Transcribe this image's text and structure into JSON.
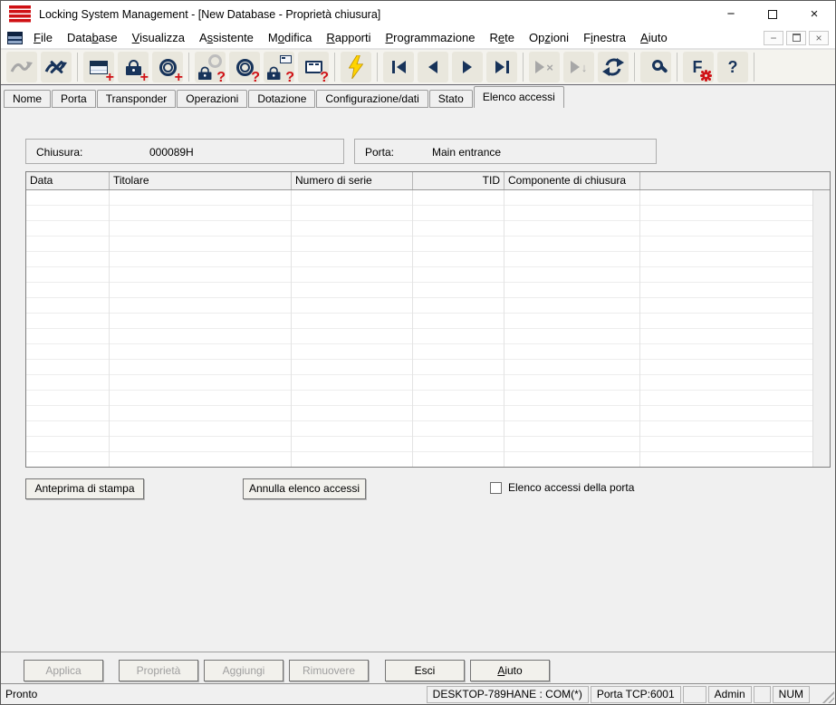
{
  "window": {
    "title": "Locking System Management - [New Database - Proprietà chiusura]",
    "controls": {
      "minimize": "−",
      "close": "×"
    }
  },
  "menubar": {
    "items": [
      {
        "pre": "",
        "key": "F",
        "post": "ile"
      },
      {
        "pre": "Data",
        "key": "b",
        "post": "ase"
      },
      {
        "pre": "",
        "key": "V",
        "post": "isualizza"
      },
      {
        "pre": "A",
        "key": "s",
        "post": "sistente"
      },
      {
        "pre": "M",
        "key": "o",
        "post": "difica"
      },
      {
        "pre": "",
        "key": "R",
        "post": "apporti"
      },
      {
        "pre": "",
        "key": "P",
        "post": "rogrammazione"
      },
      {
        "pre": "R",
        "key": "e",
        "post": "te"
      },
      {
        "pre": "Op",
        "key": "z",
        "post": "ioni"
      },
      {
        "pre": "F",
        "key": "i",
        "post": "nestra"
      },
      {
        "pre": "",
        "key": "A",
        "post": "iuto"
      }
    ]
  },
  "toolbar": {
    "icon_names": [
      "connect",
      "disconnect",
      "new-locking-plan",
      "new-lock",
      "new-transponder",
      "read-lock",
      "read-transponder",
      "read-network-lock",
      "read-settings",
      "program",
      "first-record",
      "previous-record",
      "next-record",
      "last-record",
      "skip-deactivated",
      "skip-down",
      "refresh",
      "search",
      "filter-settings",
      "help"
    ],
    "plus": "+",
    "question": "?",
    "down_arrow": "↓",
    "x_glyph": "×",
    "filter_letter": "F",
    "help_glyph": "?"
  },
  "tabs": {
    "items": [
      "Nome",
      "Porta",
      "Transponder",
      "Operazioni",
      "Dotazione",
      "Configurazione/dati",
      "Stato",
      "Elenco accessi"
    ],
    "active": "Elenco accessi"
  },
  "fields": {
    "chiusura": {
      "label": "Chiusura:",
      "value": "000089H"
    },
    "porta": {
      "label": "Porta:",
      "value": "Main entrance"
    }
  },
  "table": {
    "columns": [
      "Data",
      "Titolare",
      "Numero di serie",
      "TID",
      "Componente di chiusura",
      ""
    ],
    "rows": []
  },
  "actions": {
    "print_preview": "Anteprima di stampa",
    "cancel_access_list": "Annulla elenco accessi",
    "door_access_checkbox": "Elenco accessi della porta",
    "door_access_checked": false
  },
  "dialog_buttons": [
    {
      "label": "Applica",
      "enabled": false
    },
    {
      "label": "Proprietà",
      "enabled": false
    },
    {
      "label": "Aggiungi",
      "enabled": false
    },
    {
      "label": "Rimuovere",
      "enabled": false
    },
    {
      "label": "Esci",
      "enabled": true
    },
    {
      "key": "A",
      "post": "iuto",
      "enabled": true
    }
  ],
  "statusbar": {
    "status": "Pronto",
    "segments": [
      "DESKTOP-789HANE : COM(*)",
      "Porta TCP:6001",
      "",
      "Admin",
      "",
      "NUM"
    ]
  },
  "colors": {
    "logo_red": "#cf1014",
    "icon_navy": "#17335a",
    "icon_red": "#d01217",
    "toolbar_button": "#e9e7dd"
  }
}
